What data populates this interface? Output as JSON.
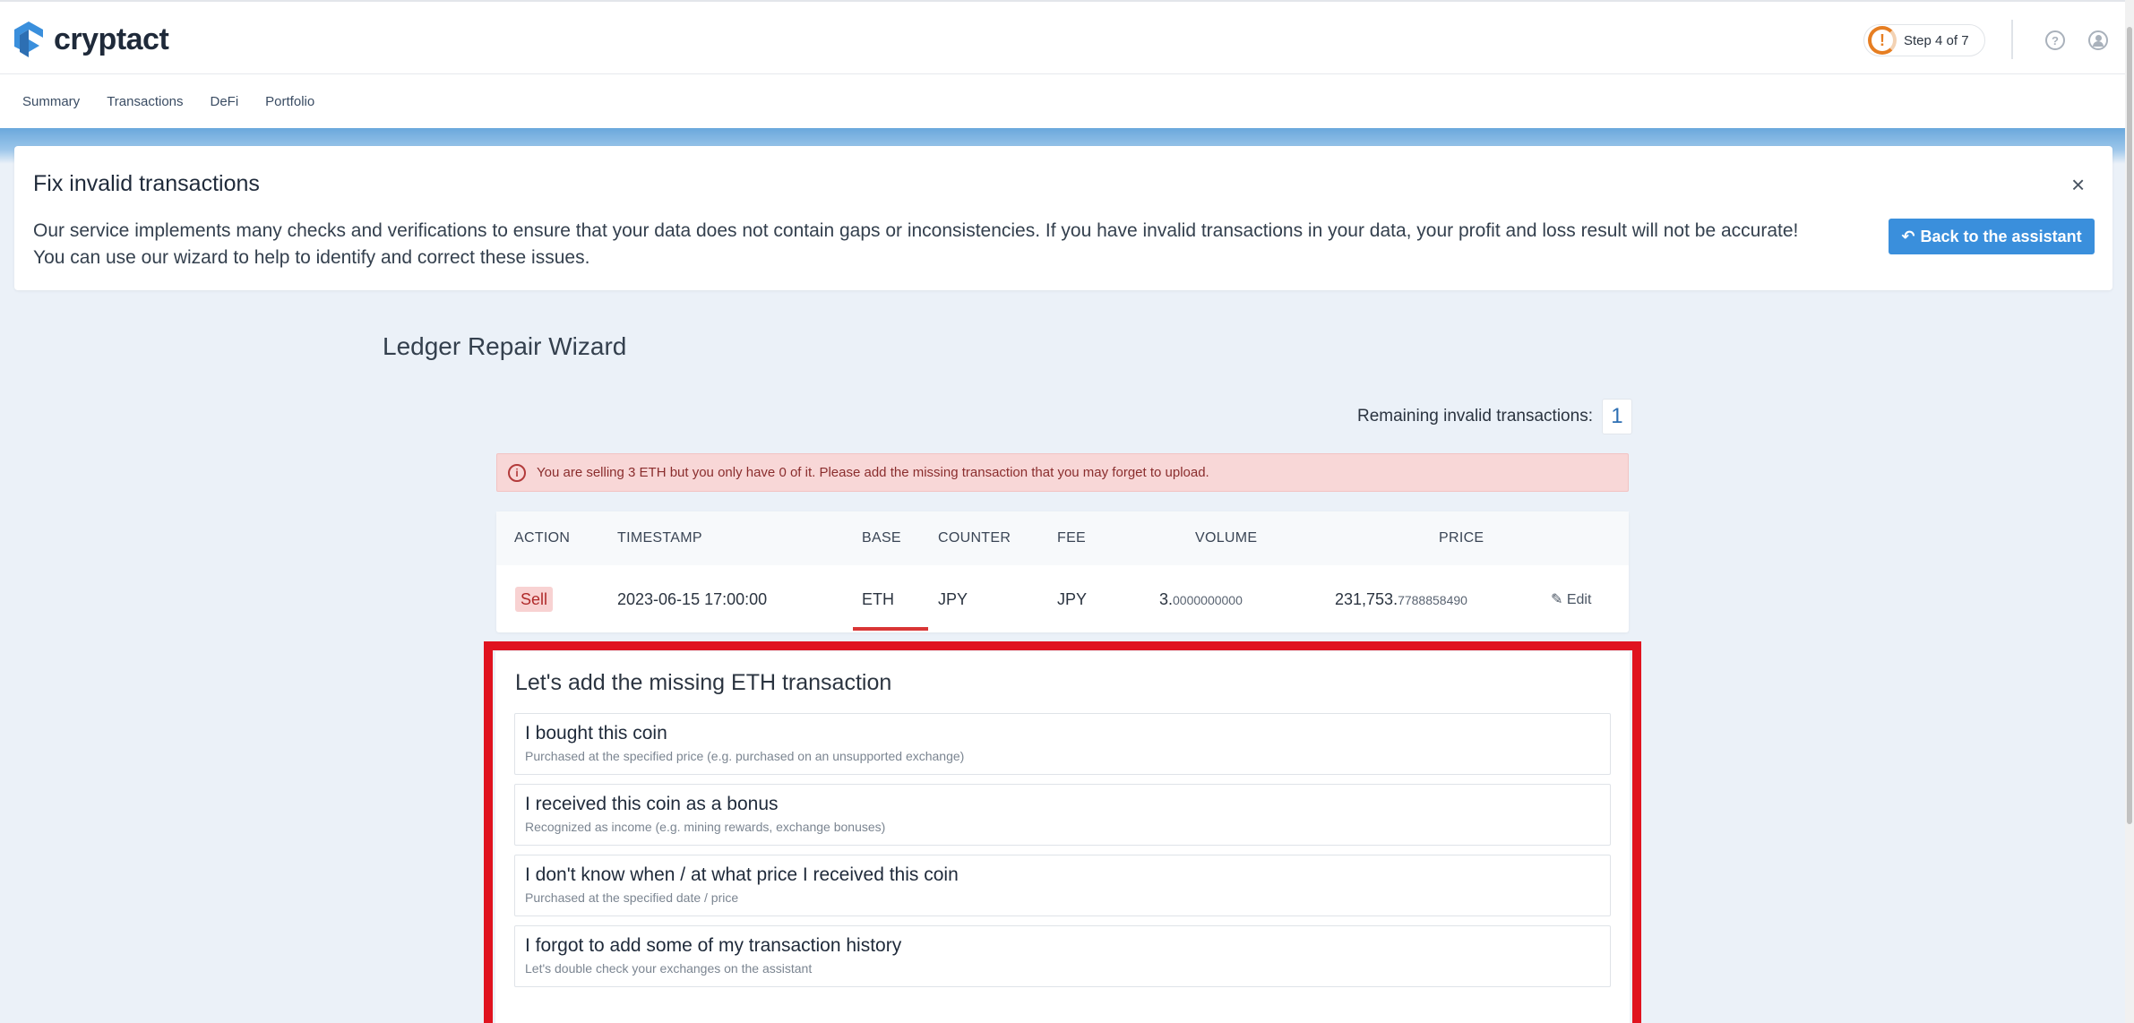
{
  "app": {
    "logo_text": "cryptact",
    "brand_color": "#3a8fdc"
  },
  "header": {
    "step_text": "Step 4 of 7",
    "step_icon": "exclamation-icon",
    "help_icon": "question-icon",
    "user_icon": "user-icon"
  },
  "nav": {
    "items": [
      {
        "label": "Summary"
      },
      {
        "label": "Transactions"
      },
      {
        "label": "DeFi"
      },
      {
        "label": "Portfolio"
      }
    ]
  },
  "fix_card": {
    "title": "Fix invalid transactions",
    "close_label": "×",
    "text_line1": "Our service implements many checks and verifications to ensure that your data does not contain gaps or inconsistencies. If you have invalid transactions in your data, your profit and loss result will not be accurate!",
    "text_line2": "You can use our wizard to help to identify and correct these issues.",
    "back_button": "Back to the assistant"
  },
  "wizard": {
    "title": "Ledger Repair Wizard",
    "remaining_label": "Remaining invalid transactions:",
    "remaining_count": "1",
    "alert_text": "You are selling 3 ETH but you only have 0 of it. Please add the missing transaction that you may forget to upload."
  },
  "table": {
    "headers": {
      "action": "ACTION",
      "timestamp": "TIMESTAMP",
      "base": "BASE",
      "counter": "COUNTER",
      "fee": "FEE",
      "volume": "VOLUME",
      "price": "PRICE"
    },
    "row": {
      "action": "Sell",
      "timestamp": "2023-06-15 17:00:00",
      "base": "ETH",
      "counter": "JPY",
      "fee": "JPY",
      "volume_int": "3.",
      "volume_dec": "0000000000",
      "price_int": "231,753.",
      "price_dec": "7788858490",
      "edit_label": "Edit"
    }
  },
  "options": {
    "title": "Let's add the missing ETH transaction",
    "items": [
      {
        "title": "I bought this coin",
        "desc": "Purchased at the specified price (e.g. purchased on an unsupported exchange)"
      },
      {
        "title": "I received this coin as a bonus",
        "desc": "Recognized as income (e.g. mining rewards, exchange bonuses)"
      },
      {
        "title": "I don't know when / at what price I received this coin",
        "desc": "Purchased at the specified date / price"
      },
      {
        "title": "I forgot to add some of my transaction history",
        "desc": "Let's double check your exchanges on the assistant"
      }
    ]
  }
}
